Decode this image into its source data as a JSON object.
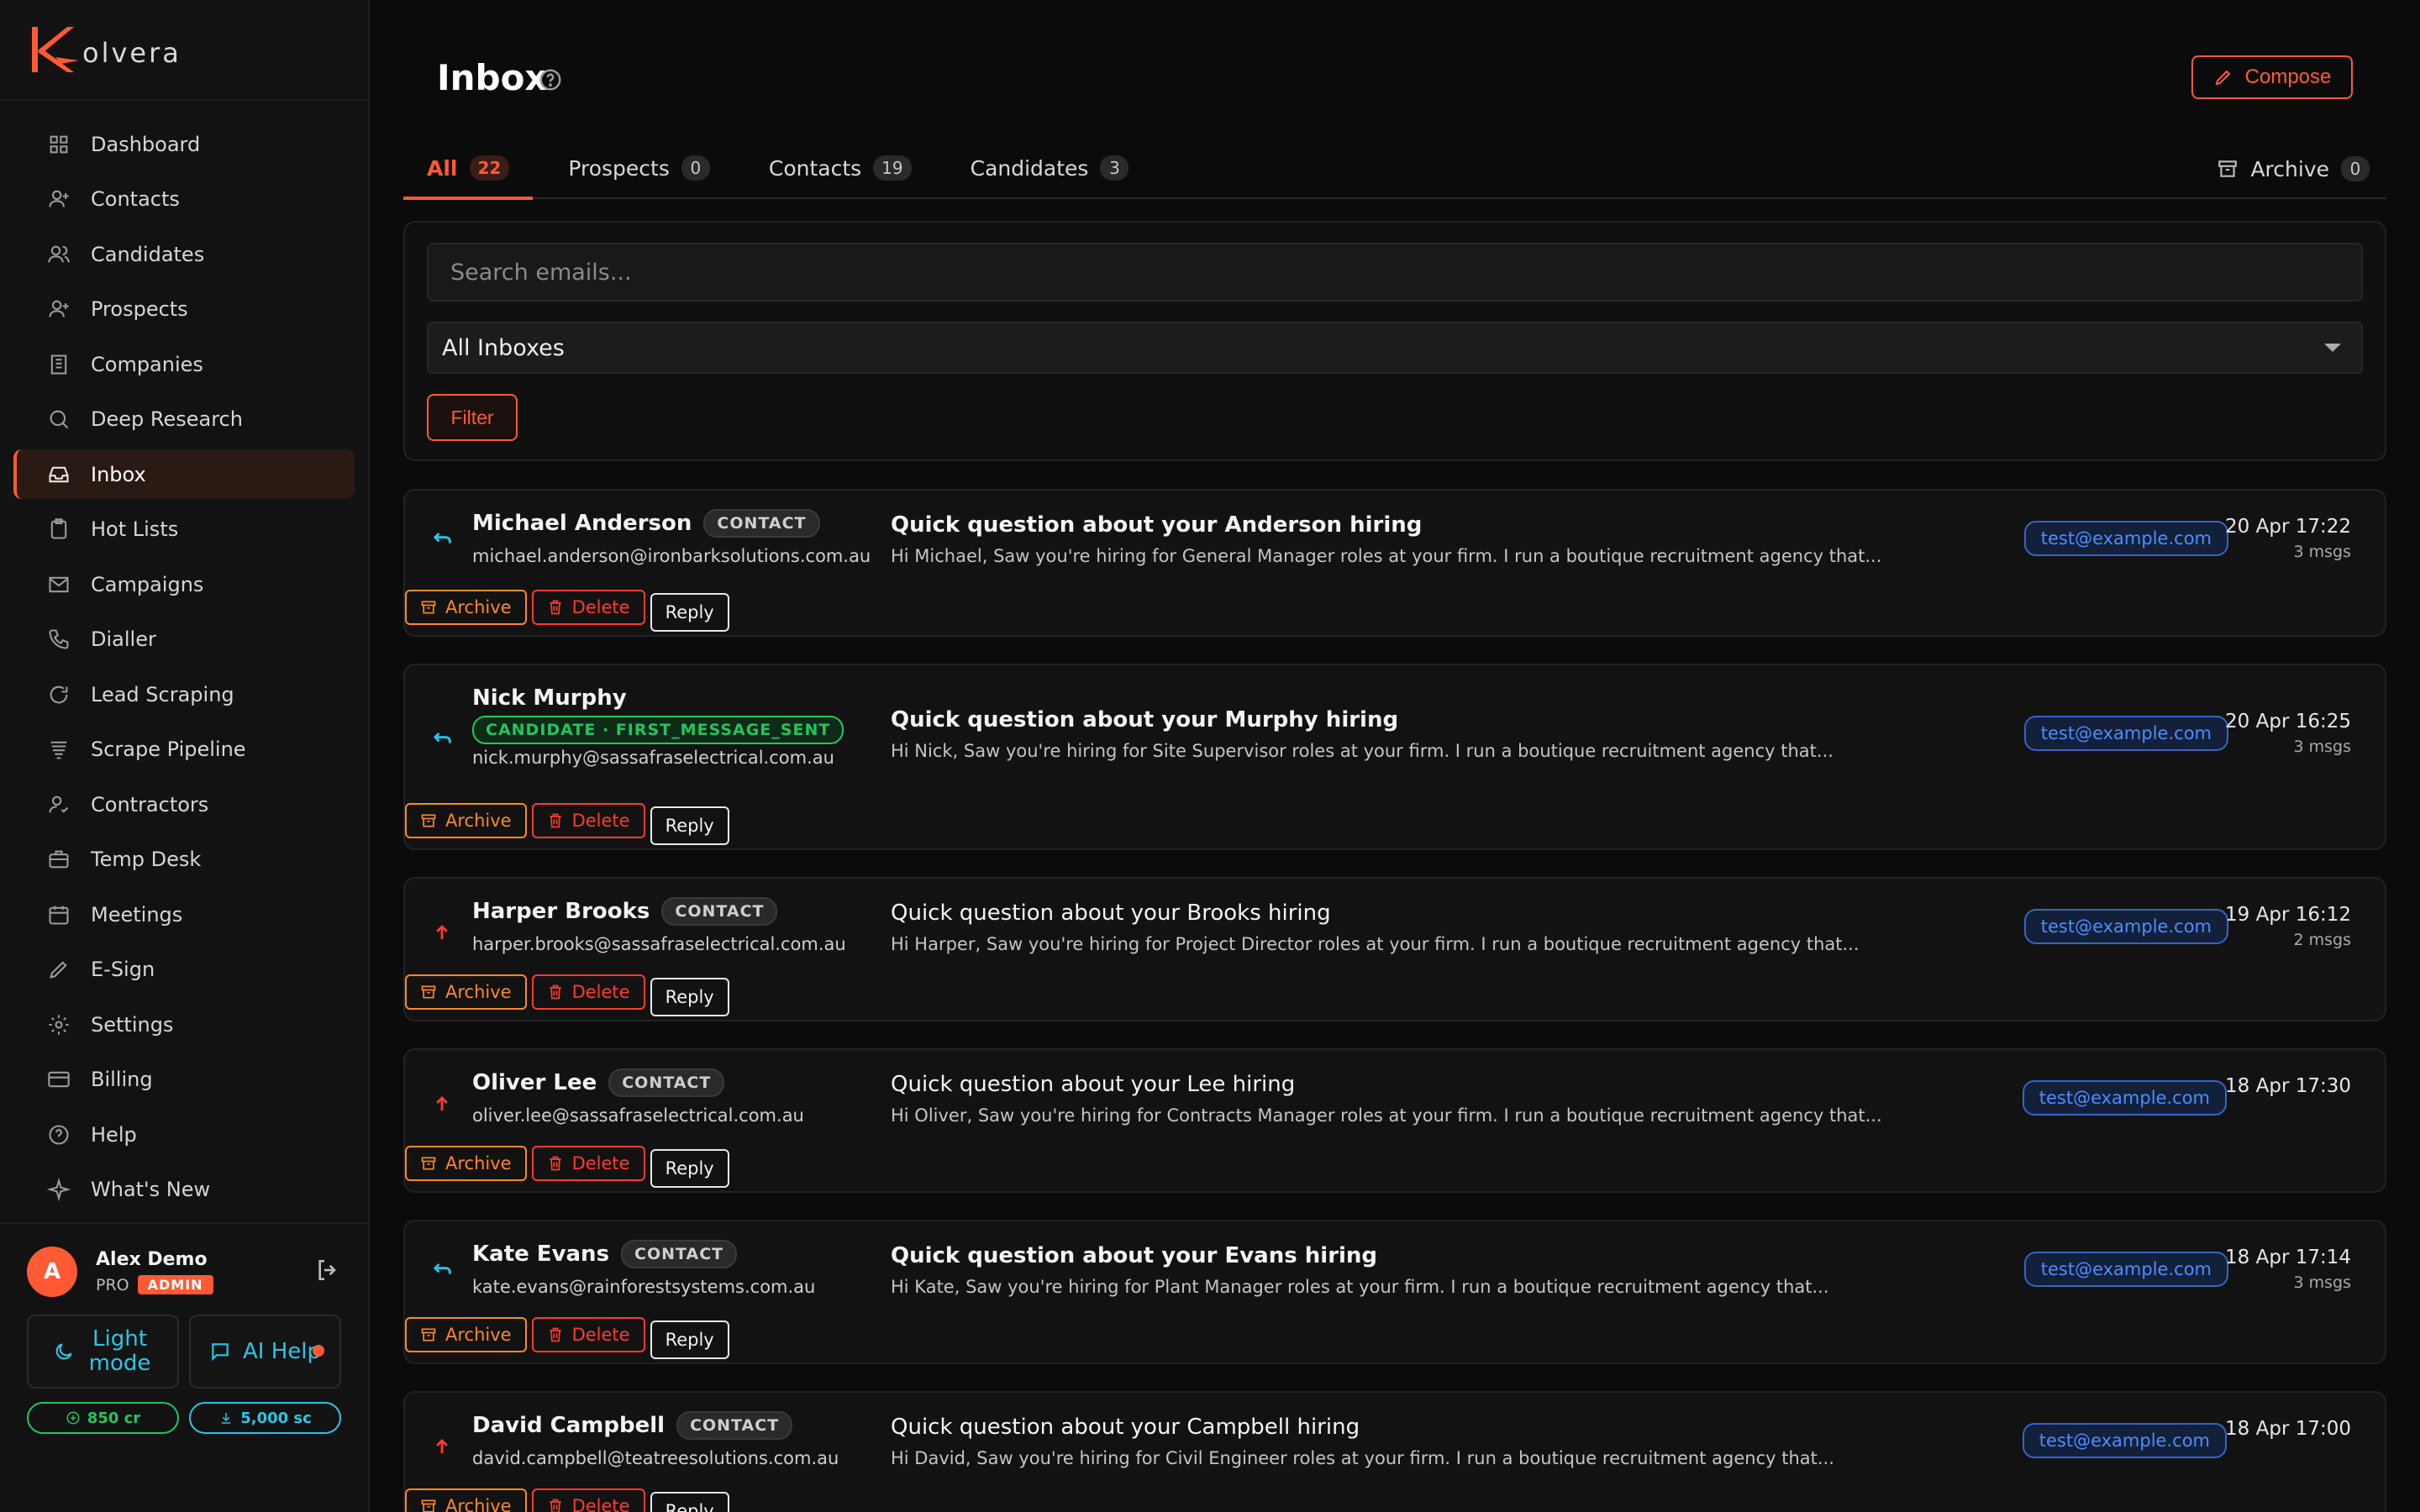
{
  "brand": {
    "logo_letter": "K",
    "logo_rest": "olvera"
  },
  "sidebar": {
    "items": [
      {
        "label": "Dashboard",
        "icon": "grid-icon"
      },
      {
        "label": "Contacts",
        "icon": "user-plus-icon"
      },
      {
        "label": "Candidates",
        "icon": "users-icon"
      },
      {
        "label": "Prospects",
        "icon": "user-plus-icon"
      },
      {
        "label": "Companies",
        "icon": "building-icon"
      },
      {
        "label": "Deep Research",
        "icon": "search-icon"
      },
      {
        "label": "Inbox",
        "icon": "inbox-icon",
        "active": true
      },
      {
        "label": "Hot Lists",
        "icon": "clipboard-icon"
      },
      {
        "label": "Campaigns",
        "icon": "mail-icon"
      },
      {
        "label": "Dialler",
        "icon": "phone-icon"
      },
      {
        "label": "Lead Scraping",
        "icon": "refresh-icon"
      },
      {
        "label": "Scrape Pipeline",
        "icon": "layers-icon"
      },
      {
        "label": "Contractors",
        "icon": "user-check-icon"
      },
      {
        "label": "Temp Desk",
        "icon": "briefcase-icon"
      },
      {
        "label": "Meetings",
        "icon": "calendar-icon"
      },
      {
        "label": "E-Sign",
        "icon": "pen-icon"
      },
      {
        "label": "Settings",
        "icon": "gear-icon"
      },
      {
        "label": "Billing",
        "icon": "credit-card-icon"
      },
      {
        "label": "Help",
        "icon": "help-circle-icon"
      },
      {
        "label": "What's New",
        "icon": "sparkle-icon"
      }
    ]
  },
  "user": {
    "initial": "A",
    "name": "Alex Demo",
    "plan": "PRO",
    "role_badge": "ADMIN",
    "light_mode_label": "Light mode",
    "ai_help_label": "AI Help",
    "credits": "850 cr",
    "scrape_credits": "5,000 sc"
  },
  "header": {
    "title": "Inbox",
    "compose_label": "Compose"
  },
  "tabs": [
    {
      "label": "All",
      "count": "22",
      "active": true
    },
    {
      "label": "Prospects",
      "count": "0"
    },
    {
      "label": "Contacts",
      "count": "19"
    },
    {
      "label": "Candidates",
      "count": "3"
    }
  ],
  "archive_tab": {
    "label": "Archive",
    "count": "0"
  },
  "filters": {
    "search_placeholder": "Search emails...",
    "inbox_select": "All Inboxes",
    "filter_label": "Filter"
  },
  "actions": {
    "archive": "Archive",
    "delete": "Delete",
    "reply": "Reply"
  },
  "emails": [
    {
      "direction": "replied",
      "name": "Michael Anderson",
      "tag": "CONTACT",
      "tag_type": "contact",
      "email": "michael.anderson@ironbarksolutions.com.au",
      "subject": "Quick question about your Anderson hiring",
      "preview": "Hi Michael, Saw you're hiring for General Manager roles at your firm. I run a boutique recruitment agency that...",
      "to": "test@example.com",
      "date": "20 Apr 17:22",
      "msgs": "3 msgs",
      "bold": true
    },
    {
      "direction": "replied",
      "name": "Nick Murphy",
      "tag": "CANDIDATE · FIRST_MESSAGE_SENT",
      "tag_type": "candidate",
      "email": "nick.murphy@sassafraselectrical.com.au",
      "subject": "Quick question about your Murphy hiring",
      "preview": "Hi Nick, Saw you're hiring for Site Supervisor roles at your firm. I run a boutique recruitment agency that...",
      "to": "test@example.com",
      "date": "20 Apr 16:25",
      "msgs": "3 msgs",
      "bold": true
    },
    {
      "direction": "sent",
      "name": "Harper Brooks",
      "tag": "CONTACT",
      "tag_type": "contact",
      "email": "harper.brooks@sassafraselectrical.com.au",
      "subject": "Quick question about your Brooks hiring",
      "preview": "Hi Harper, Saw you're hiring for Project Director roles at your firm. I run a boutique recruitment agency that...",
      "to": "test@example.com",
      "date": "19 Apr 16:12",
      "msgs": "2 msgs",
      "bold": false
    },
    {
      "direction": "sent",
      "name": "Oliver Lee",
      "tag": "CONTACT",
      "tag_type": "contact",
      "email": "oliver.lee@sassafraselectrical.com.au",
      "subject": "Quick question about your Lee hiring",
      "preview": "Hi Oliver, Saw you're hiring for Contracts Manager roles at your firm. I run a boutique recruitment agency that...",
      "to": "test@example.com",
      "date": "18 Apr 17:30",
      "msgs": "",
      "bold": false
    },
    {
      "direction": "replied",
      "name": "Kate Evans",
      "tag": "CONTACT",
      "tag_type": "contact",
      "email": "kate.evans@rainforestsystems.com.au",
      "subject": "Quick question about your Evans hiring",
      "preview": "Hi Kate, Saw you're hiring for Plant Manager roles at your firm. I run a boutique recruitment agency that...",
      "to": "test@example.com",
      "date": "18 Apr 17:14",
      "msgs": "3 msgs",
      "bold": true
    },
    {
      "direction": "sent",
      "name": "David Campbell",
      "tag": "CONTACT",
      "tag_type": "contact",
      "email": "david.campbell@teatreesolutions.com.au",
      "subject": "Quick question about your Campbell hiring",
      "preview": "Hi David, Saw you're hiring for Civil Engineer roles at your firm. I run a boutique recruitment agency that...",
      "to": "test@example.com",
      "date": "18 Apr 17:00",
      "msgs": "",
      "bold": false
    }
  ],
  "colors": {
    "accent": "#ff5a33",
    "cyan": "#29c6e6",
    "green": "#22c55e",
    "blue": "#4b8dff"
  }
}
